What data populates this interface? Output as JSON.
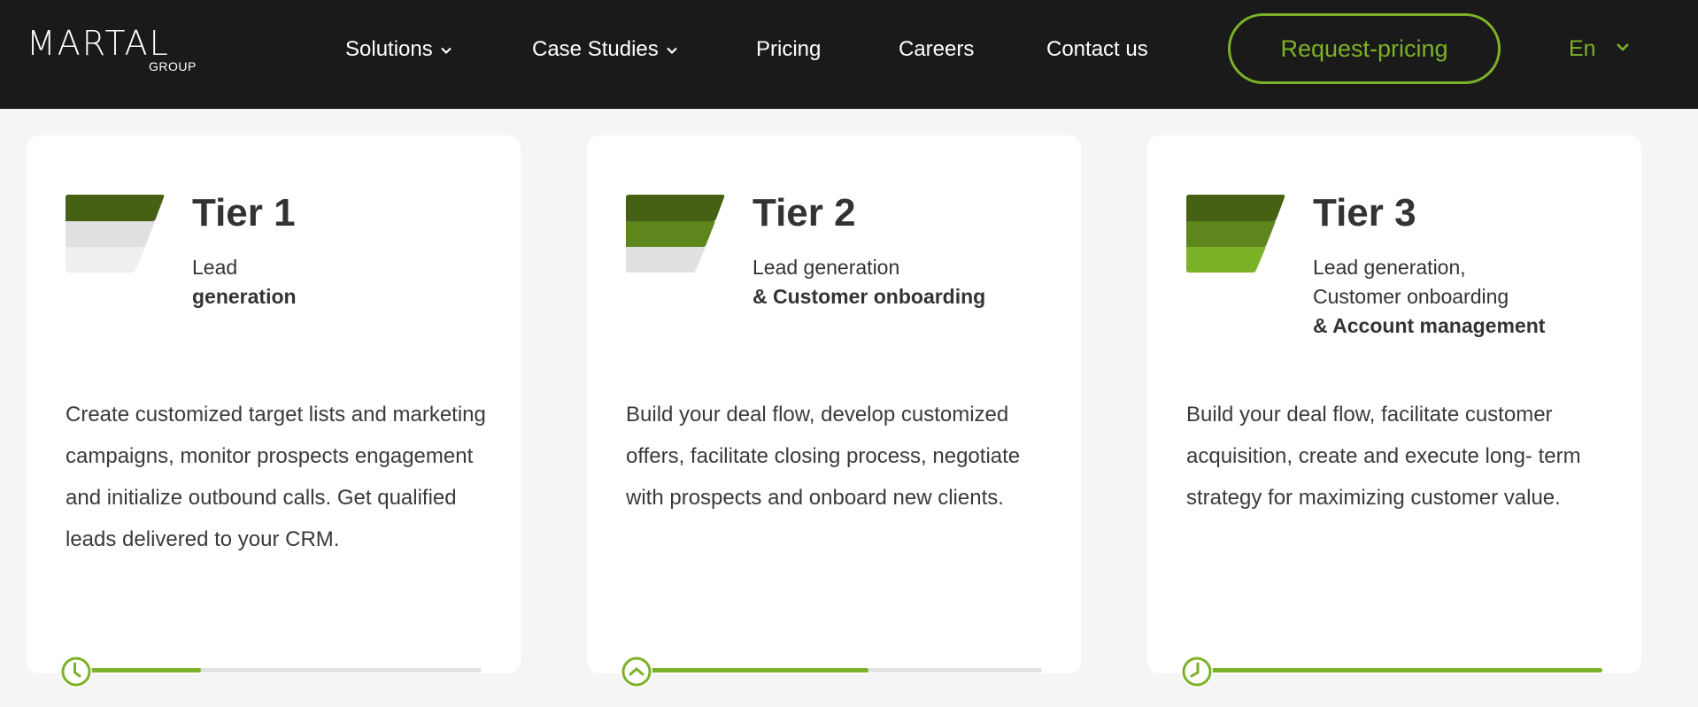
{
  "header": {
    "logo": {
      "name": "MARTAL",
      "sub": "GROUP"
    },
    "nav": [
      {
        "label": "Solutions",
        "has_dropdown": true
      },
      {
        "label": "Case Studies",
        "has_dropdown": true
      },
      {
        "label": "Pricing",
        "has_dropdown": false
      },
      {
        "label": "Careers",
        "has_dropdown": false
      },
      {
        "label": "Contact us",
        "has_dropdown": false
      }
    ],
    "cta_label": "Request-pricing",
    "language": "En"
  },
  "colors": {
    "accent": "#7cb227",
    "dark_green": "#476114",
    "mid_green": "#5d861c",
    "light_green": "#7cb227",
    "inactive_1": "#e0e0e0",
    "inactive_2": "#efefef",
    "header_bg": "#1a1a1a"
  },
  "tiers": [
    {
      "title": "Tier 1",
      "subtitle_lines": [
        "Lead"
      ],
      "subtitle_bold": "generation",
      "levels_filled": 1,
      "description": "Create customized target lists and marketing campaigns, monitor prospects engagement and initialize outbound calls. Get qualified leads delivered to your CRM.",
      "progress_icon": "clock-icon",
      "progress": 0.29
    },
    {
      "title": "Tier 2",
      "subtitle_lines": [
        "Lead generation"
      ],
      "subtitle_bold": "& Customer onboarding",
      "levels_filled": 2,
      "description": "Build your deal flow, develop customized offers, facilitate closing process, negotiate with prospects and onboard new clients.",
      "progress_icon": "chevron-up-circle-icon",
      "progress": 0.56
    },
    {
      "title": "Tier 3",
      "subtitle_lines": [
        "Lead generation,",
        "Customer onboarding"
      ],
      "subtitle_bold": "& Account management",
      "levels_filled": 3,
      "description": "Build your deal flow, facilitate customer acquisition, create and execute long- term strategy for maximizing customer value.",
      "progress_icon": "clock-icon",
      "progress": 1.0
    }
  ]
}
